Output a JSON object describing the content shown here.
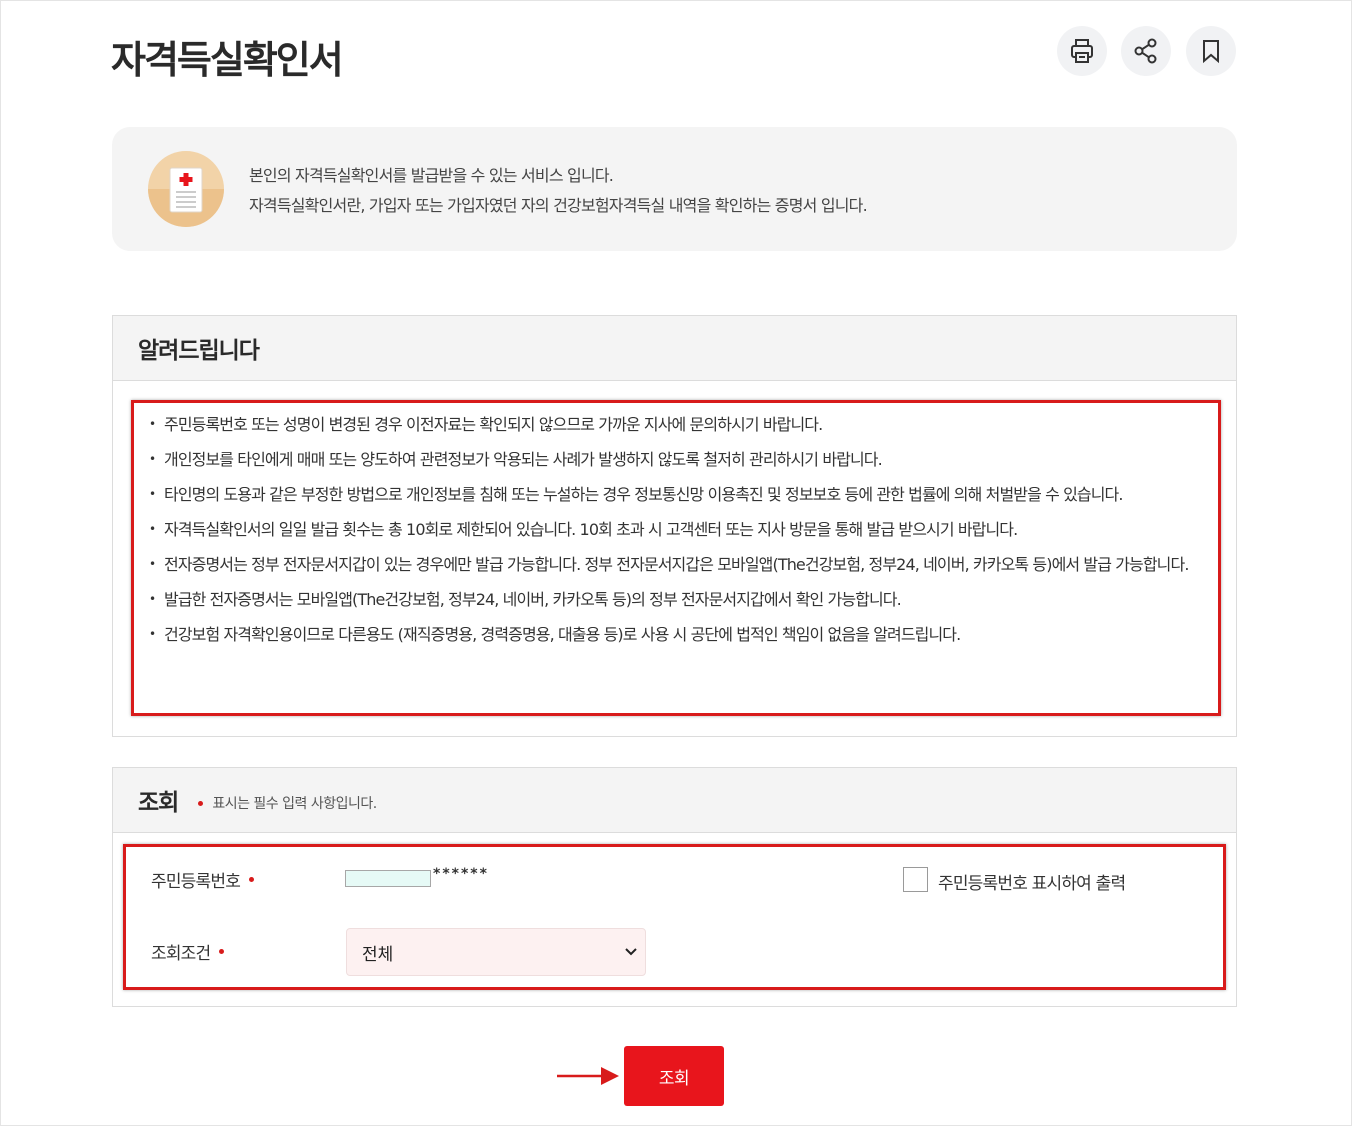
{
  "page": {
    "title": "자격득실확인서"
  },
  "toolbar": {
    "print_icon": "print-icon",
    "share_icon": "share-icon",
    "bookmark_icon": "bookmark-icon"
  },
  "intro": {
    "line1": "본인의 자격득실확인서를 발급받을 수 있는 서비스 입니다.",
    "line2": "자격득실확인서란, 가입자 또는 가입자였던 자의 건강보험자격득실 내역을 확인하는 증명서 입니다."
  },
  "notice": {
    "heading": "알려드립니다",
    "items": [
      "주민등록번호 또는 성명이 변경된 경우 이전자료는 확인되지 않으므로 가까운 지사에 문의하시기 바랍니다.",
      "개인정보를 타인에게 매매 또는 양도하여 관련정보가 악용되는 사례가 발생하지 않도록 철저히 관리하시기 바랍니다.",
      "타인명의 도용과 같은 부정한 방법으로 개인정보를 침해 또는 누설하는 경우 정보통신망 이용촉진 및 정보보호 등에 관한 법률에 의해 처벌받을 수 있습니다.",
      "자격득실확인서의 일일 발급 횟수는 총 10회로 제한되어 있습니다. 10회 초과 시 고객센터 또는 지사 방문을 통해 발급 받으시기 바랍니다.",
      "전자증명서는 정부 전자문서지갑이 있는 경우에만 발급 가능합니다. 정부 전자문서지갑은 모바일앱(The건강보험, 정부24, 네이버, 카카오톡 등)에서 발급 가능합니다.",
      "발급한 전자증명서는 모바일앱(The건강보험, 정부24, 네이버, 카카오톡 등)의 정부 전자문서지갑에서 확인 가능합니다.",
      "건강보험 자격확인용이므로 다른용도 (재직증명용, 경력증명용, 대출용 등)로 사용 시 공단에 법적인 책임이 없음을 알려드립니다."
    ]
  },
  "query": {
    "heading": "조회",
    "required_note": "표시는 필수 입력 사항입니다.",
    "rrn_label": "주민등록번호",
    "rrn_value": "",
    "rrn_mask": "******",
    "show_rrn_label": "주민등록번호 표시하여 출력",
    "show_rrn_checked": false,
    "condition_label": "조회조건",
    "condition_selected": "전체"
  },
  "submit": {
    "label": "조회"
  },
  "colors": {
    "accent": "#e8151c",
    "highlight": "#d81b1b"
  }
}
